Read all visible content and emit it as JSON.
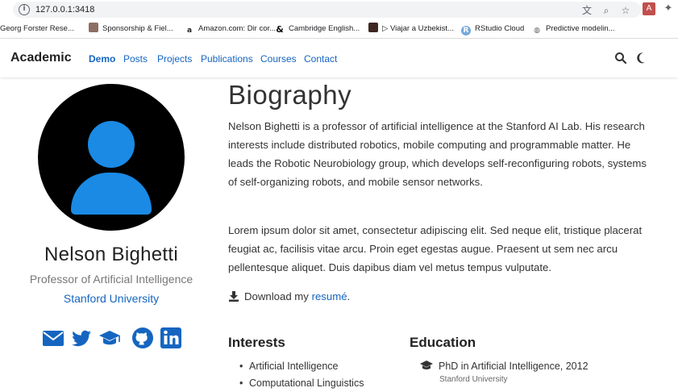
{
  "browser": {
    "url": "127.0.0.1:3418",
    "bookmarks": [
      {
        "label": "Georg Forster Rese...",
        "icon": "bookmark-site-icon"
      },
      {
        "label": "Sponsorship & Fiel...",
        "icon": "bookmark-site-icon"
      },
      {
        "label": "Amazon.com: Dir cor...",
        "icon": "amazon-icon"
      },
      {
        "label": "Cambridge English...",
        "icon": "cambridge-icon"
      },
      {
        "label": "▷ Viajar a Uzbekist...",
        "icon": "bookmark-site-icon"
      },
      {
        "label": "RStudio Cloud",
        "icon": "rstudio-icon"
      },
      {
        "label": "Predictive modelin...",
        "icon": "globe-icon"
      }
    ]
  },
  "nav": {
    "brand": "Academic",
    "links": [
      "Demo",
      "Posts",
      "Projects",
      "Publications",
      "Courses",
      "Contact"
    ],
    "active": "Demo"
  },
  "profile": {
    "name": "Nelson Bighetti",
    "role": "Professor of Artificial Intelligence",
    "organization": "Stanford University"
  },
  "bio": {
    "title": "Biography",
    "p1": "Nelson Bighetti is a professor of artificial intelligence at the Stanford AI Lab. His research interests include distributed robotics, mobile computing and programmable matter. He leads the Robotic Neurobiology group, which develops self-reconfiguring robots, systems of self-organizing robots, and mobile sensor networks.",
    "p2": "Lorem ipsum dolor sit amet, consectetur adipiscing elit. Sed neque elit, tristique placerat feugiat ac, facilisis vitae arcu. Proin eget egestas augue. Praesent ut sem nec arcu pellentesque aliquet. Duis dapibus diam vel metus tempus vulputate.",
    "download_prefix": "Download my ",
    "download_link": "resumé",
    "download_suffix": "."
  },
  "interests": {
    "title": "Interests",
    "items": [
      "Artificial Intelligence",
      "Computational Linguistics"
    ]
  },
  "education": {
    "title": "Education",
    "items": [
      {
        "degree": "PhD in Artificial Intelligence, 2012",
        "institution": "Stanford University"
      }
    ]
  },
  "colors": {
    "accent": "#1565c0",
    "avatar_fill": "#1a8ae5"
  }
}
